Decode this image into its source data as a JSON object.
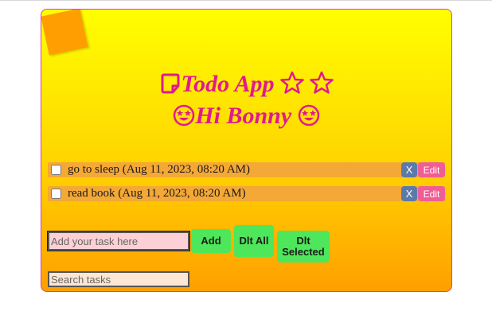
{
  "header": {
    "title": "Todo App",
    "greeting": "Hi Bonny"
  },
  "icons": {
    "title_icon": "sticky-note-icon",
    "stars": "star-outline-icon",
    "emoji": "star-struck-face-icon"
  },
  "colors": {
    "accent_pink": "#e01a8e",
    "gradient_top": "#ffff00",
    "gradient_bottom": "#ff9f00",
    "task_bg": "#f4a836",
    "delete_button": "#5b7aa8",
    "edit_button": "#ef5d94",
    "action_button": "#4ee65a"
  },
  "tasks": [
    {
      "text": "go to sleep (Aug 11, 2023, 08:20 AM)",
      "checked": false,
      "delete_label": "X",
      "edit_label": "Edit"
    },
    {
      "text": "read book (Aug 11, 2023, 08:20 AM)",
      "checked": false,
      "delete_label": "X",
      "edit_label": "Edit"
    }
  ],
  "form": {
    "task_input_placeholder": "Add your task here",
    "add_label": "Add",
    "delete_all_label": "Dlt All",
    "delete_selected_label": "Dlt Selected",
    "search_placeholder": "Search tasks"
  }
}
